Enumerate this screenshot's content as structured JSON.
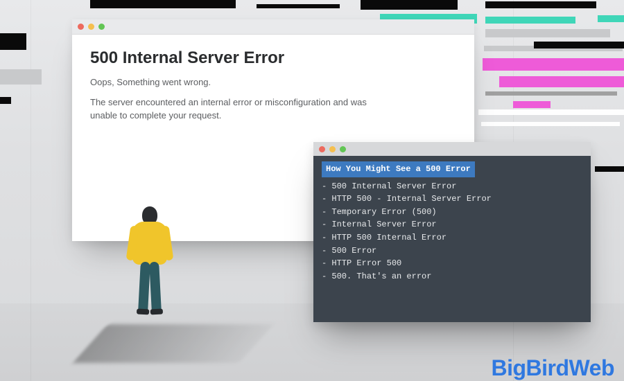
{
  "error_window": {
    "heading": "500 Internal Server Error",
    "subheading": "Oops, Something went wrong.",
    "body": "The server encountered an internal error or misconfiguration and was unable to complete your request."
  },
  "terminal": {
    "title": "How You Might See a 500 Error",
    "items": [
      "500 Internal Server Error",
      "HTTP 500 - Internal Server Error",
      "Temporary Error (500)",
      "Internal Server Error",
      "HTTP 500 Internal Error",
      "500 Error",
      "HTTP Error 500",
      "500. That's an error"
    ]
  },
  "brand": "BigBirdWeb"
}
